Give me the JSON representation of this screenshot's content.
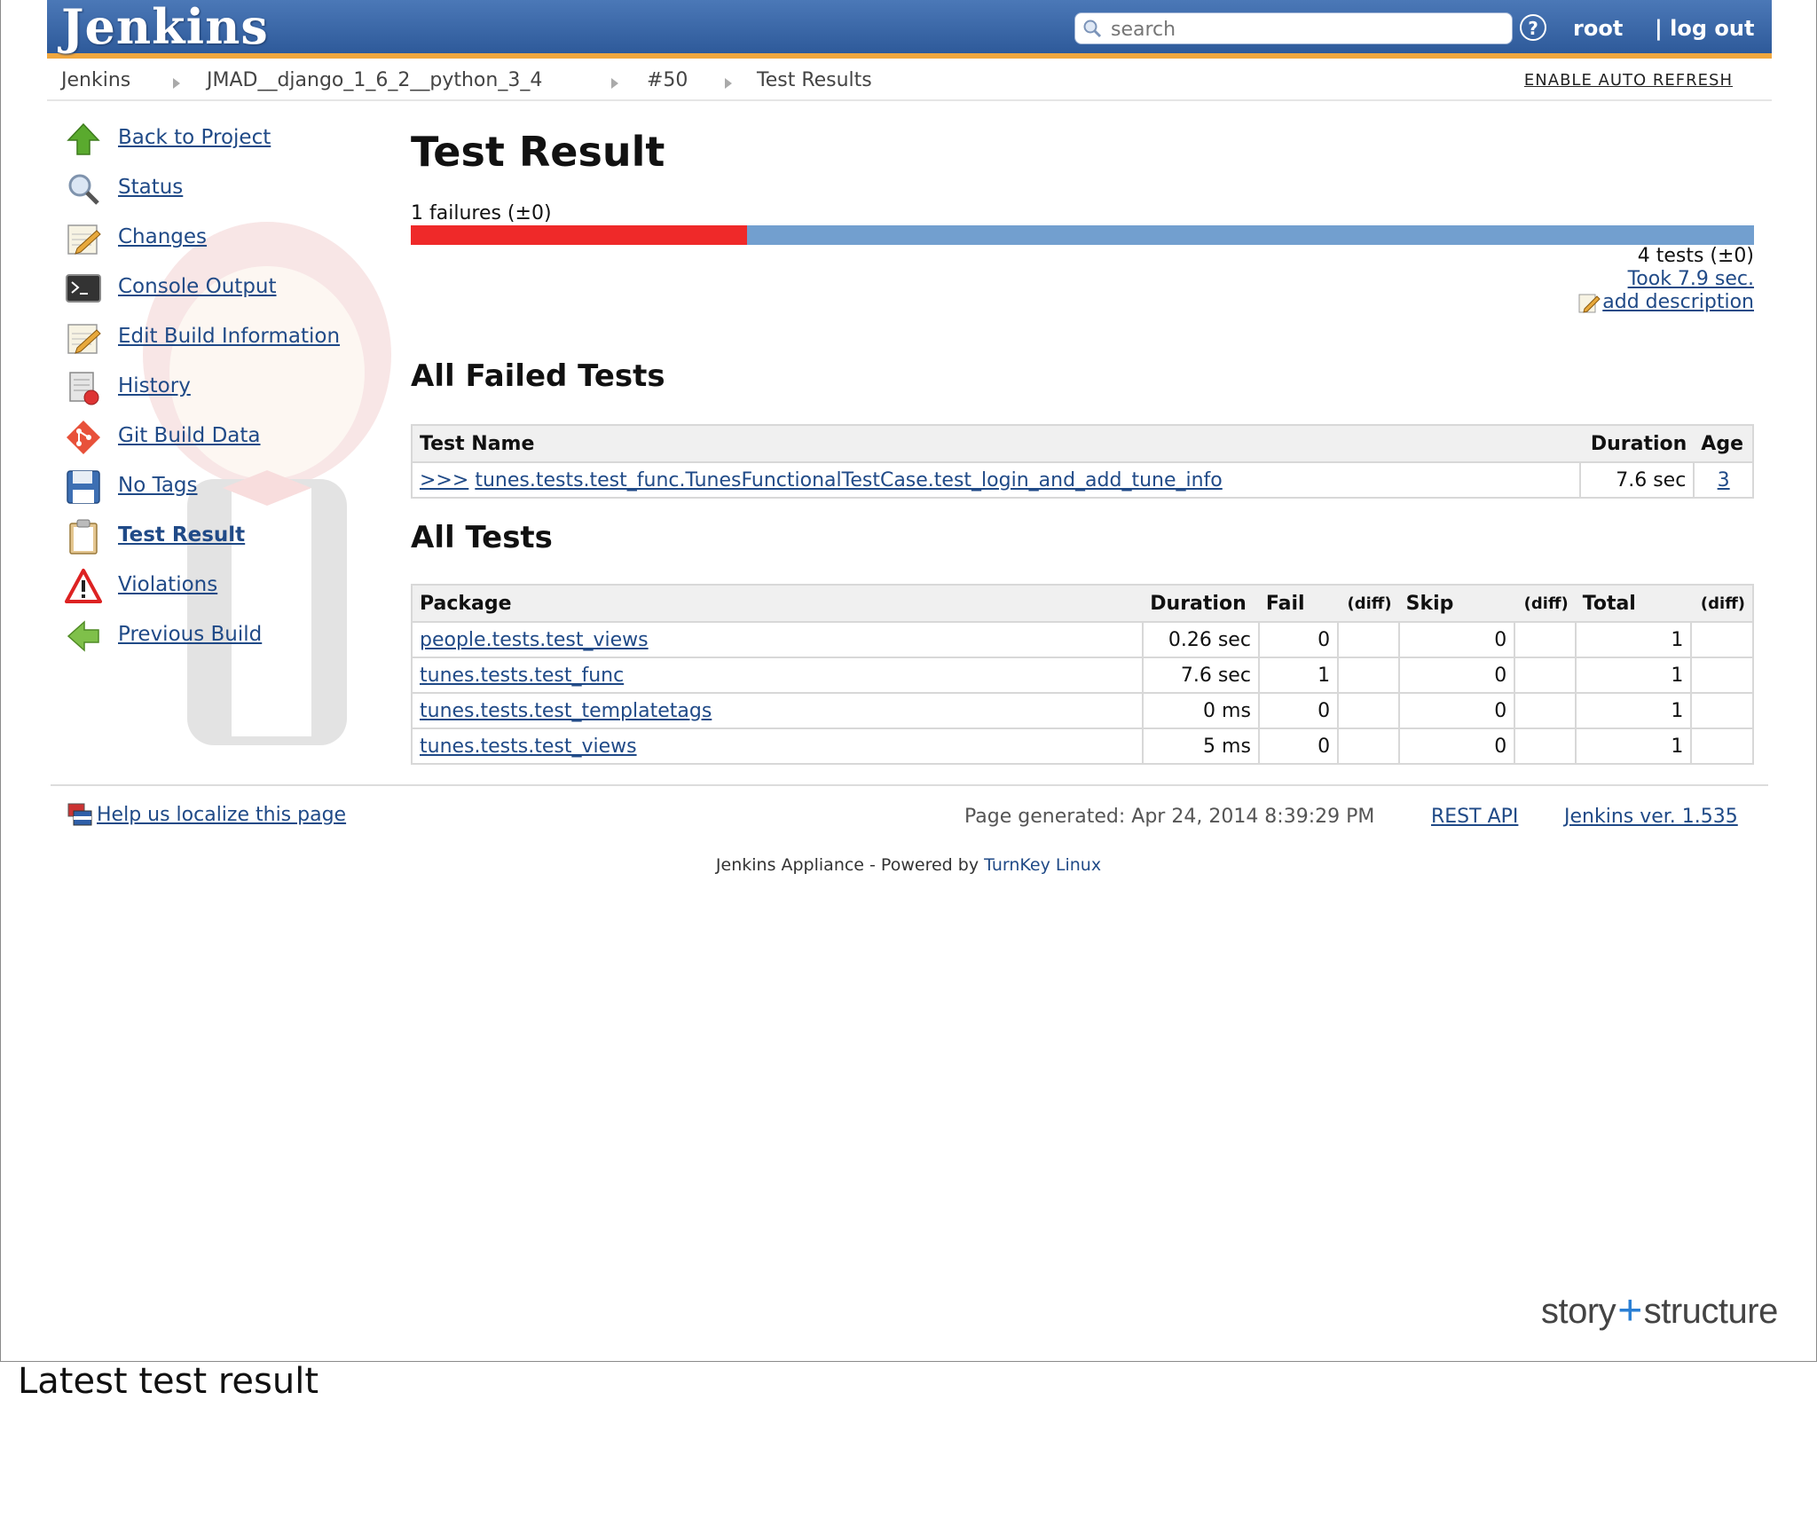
{
  "header": {
    "logo": "Jenkins",
    "search_placeholder": "search",
    "help_symbol": "?",
    "user": "root",
    "logout": "| log out"
  },
  "breadcrumb": {
    "items": [
      "Jenkins",
      "JMAD__django_1_6_2__python_3_4",
      "#50",
      "Test Results"
    ],
    "auto_refresh": "ENABLE AUTO REFRESH"
  },
  "sidebar": {
    "items": [
      {
        "label": "Back to Project",
        "icon": "up-arrow-icon"
      },
      {
        "label": "Status",
        "icon": "magnifier-icon"
      },
      {
        "label": "Changes",
        "icon": "notepad-icon"
      },
      {
        "label": "Console Output",
        "icon": "terminal-icon"
      },
      {
        "label": "Edit Build Information",
        "icon": "notepad-icon"
      },
      {
        "label": "History",
        "icon": "history-icon"
      },
      {
        "label": "Git Build Data",
        "icon": "git-icon"
      },
      {
        "label": "No Tags",
        "icon": "floppy-icon"
      },
      {
        "label": "Test Result",
        "icon": "clipboard-icon"
      },
      {
        "label": "Violations",
        "icon": "warning-icon"
      },
      {
        "label": "Previous Build",
        "icon": "left-arrow-icon"
      }
    ]
  },
  "main": {
    "title": "Test Result",
    "fail_summary": "1 failures (±0)",
    "fail_fraction": 0.25,
    "tests_count": "4 tests (±0)",
    "took": "Took 7.9 sec.",
    "add_description": "add description",
    "failed_section": {
      "title": "All Failed Tests",
      "headers": [
        "Test Name",
        "Duration",
        "Age"
      ],
      "rows": [
        {
          "prefix": ">>>",
          "name": "tunes.tests.test_func.TunesFunctionalTestCase.test_login_and_add_tune_info",
          "duration": "7.6 sec",
          "age": "3"
        }
      ]
    },
    "all_section": {
      "title": "All Tests",
      "headers": [
        "Package",
        "Duration",
        "Fail",
        "(diff)",
        "Skip",
        "(diff)",
        "Total",
        "(diff)"
      ],
      "rows": [
        {
          "package": "people.tests.test_views",
          "duration": "0.26 sec",
          "fail": "0",
          "fail_diff": "",
          "skip": "0",
          "skip_diff": "",
          "total": "1",
          "total_diff": ""
        },
        {
          "package": "tunes.tests.test_func",
          "duration": "7.6 sec",
          "fail": "1",
          "fail_diff": "",
          "skip": "0",
          "skip_diff": "",
          "total": "1",
          "total_diff": ""
        },
        {
          "package": "tunes.tests.test_templatetags",
          "duration": "0 ms",
          "fail": "0",
          "fail_diff": "",
          "skip": "0",
          "skip_diff": "",
          "total": "1",
          "total_diff": ""
        },
        {
          "package": "tunes.tests.test_views",
          "duration": "5 ms",
          "fail": "0",
          "fail_diff": "",
          "skip": "0",
          "skip_diff": "",
          "total": "1",
          "total_diff": ""
        }
      ]
    }
  },
  "footer": {
    "localize": "Help us localize this page",
    "generated": "Page generated: Apr 24, 2014 8:39:29 PM",
    "rest_api": "REST API",
    "jenkins_version": "Jenkins ver. 1.535",
    "appliance_prefix": "Jenkins Appliance - Powered by ",
    "appliance_link": "TurnKey Linux"
  },
  "brand": {
    "left": "story",
    "plus": "+",
    "right": "structure"
  },
  "caption": "Latest test result",
  "colors": {
    "fail": "#ef2929",
    "pass": "#729fcf",
    "header": "#3a67a8",
    "accent": "#f0a73e",
    "link": "#204a87"
  }
}
